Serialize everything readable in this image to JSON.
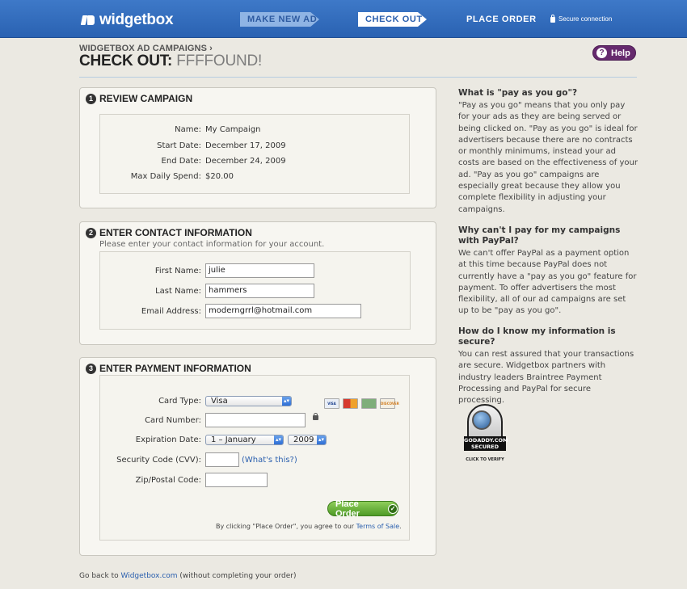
{
  "topbar": {
    "brand": "widgetbox",
    "steps": [
      "MAKE NEW AD",
      "CHECK OUT",
      "PLACE ORDER"
    ],
    "secure_label": "Secure connection"
  },
  "header": {
    "breadcrumb": "WIDGETBOX AD CAMPAIGNS ›",
    "title_prefix": "CHECK OUT:",
    "campaign_name": "FFFFOUND!",
    "help_label": "Help"
  },
  "review": {
    "number": "1",
    "title": "REVIEW CAMPAIGN",
    "rows": [
      {
        "label": "Name:",
        "value": "My Campaign"
      },
      {
        "label": "Start Date:",
        "value": "December 17, 2009"
      },
      {
        "label": "End Date:",
        "value": "December 24, 2009"
      },
      {
        "label": "Max Daily Spend:",
        "value": "$20.00"
      }
    ]
  },
  "contact": {
    "number": "2",
    "title": "ENTER CONTACT INFORMATION",
    "subtitle": "Please enter your contact information for your account.",
    "first_name_label": "First Name:",
    "first_name_value": "julie",
    "last_name_label": "Last Name:",
    "last_name_value": "hammers",
    "email_label": "Email Address:",
    "email_value": "moderngrrl@hotmail.com"
  },
  "payment": {
    "number": "3",
    "title": "ENTER PAYMENT INFORMATION",
    "card_type_label": "Card Type:",
    "card_type_value": "Visa",
    "card_number_label": "Card Number:",
    "expiration_label": "Expiration Date:",
    "exp_month": "1 – January",
    "exp_year": "2009",
    "cvv_label": "Security Code (CVV):",
    "cvv_help": "(What's this?)",
    "zip_label": "Zip/Postal Code:",
    "card_logos": [
      "VISA",
      "",
      "",
      "DISCOVER"
    ],
    "place_order_label": "Place Order",
    "terms_prefix": "By clicking \"Place Order\", you agree to our ",
    "terms_link": "Terms of Sale",
    "terms_suffix": "."
  },
  "faq": [
    {
      "q": "What is \"pay as you go\"?",
      "a": "\"Pay as you go\" means that you only pay for your ads as they are being served or being clicked on. \"Pay as you go\" is ideal for advertisers because there are no contracts or monthly minimums, instead your ad costs are based on the effectiveness of your ad. \"Pay as you go\" campaigns are especially great because they allow you complete flexibility in adjusting your campaigns."
    },
    {
      "q": "Why can't I pay for my campaigns with PayPal?",
      "a": "We can't offer PayPal as a payment option at this time because PayPal does not currently have a \"pay as you go\" feature for payment. To offer advertisers the most flexibility, all of our ad campaigns are set up to be \"pay as you go\"."
    },
    {
      "q": "How do I know my information is secure?",
      "a": "You can rest assured that your transactions are secure. Widgetbox partners with industry leaders Braintree Payment Processing and PayPal for secure processing."
    }
  ],
  "seal": {
    "band_line1": "GODADDY.COM",
    "band_line2": "SECURED",
    "verify": "CLICK TO VERIFY"
  },
  "footer": {
    "prefix": "Go back to ",
    "link": "Widgetbox.com",
    "suffix": " (without completing your order)"
  }
}
